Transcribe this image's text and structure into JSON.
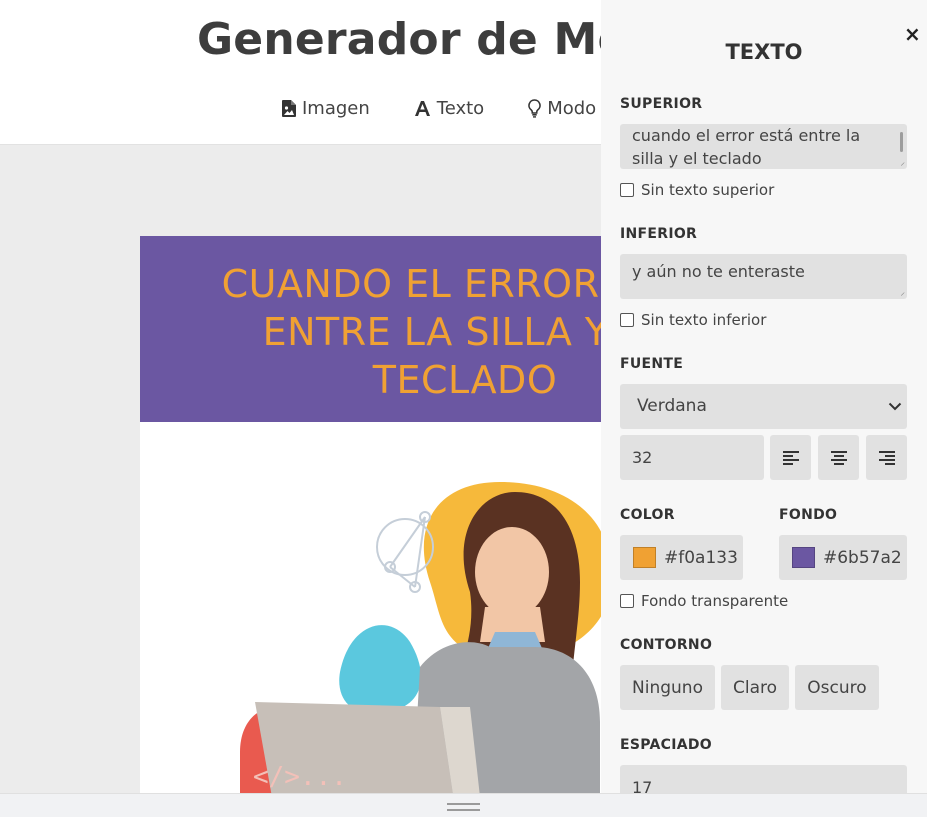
{
  "header": {
    "title": "Generador de Memes",
    "nav": [
      {
        "label": "Imagen",
        "icon": "image-file-icon"
      },
      {
        "label": "Texto",
        "icon": "font-icon"
      },
      {
        "label": "Modo oscuro",
        "icon": "lightbulb-icon"
      }
    ]
  },
  "meme": {
    "top_text": "cuando el error está entre la silla y el teclado",
    "image_caption": "</>..."
  },
  "panel": {
    "title": "TEXTO",
    "close_icon": "close-icon",
    "superior": {
      "label": "SUPERIOR",
      "value": "cuando el error está entre la silla y el teclado",
      "checkbox_label": "Sin texto superior",
      "checked": false
    },
    "inferior": {
      "label": "INFERIOR",
      "value": "y aún no te enteraste",
      "checkbox_label": "Sin texto inferior",
      "checked": false
    },
    "fuente": {
      "label": "FUENTE",
      "selected": "Verdana",
      "size": "32",
      "align_icons": [
        "align-left-icon",
        "align-center-icon",
        "align-right-icon"
      ]
    },
    "color": {
      "label": "COLOR",
      "value": "#f0a133",
      "swatch": "#f0a133"
    },
    "fondo": {
      "label": "FONDO",
      "value": "#6b57a2",
      "swatch": "#6b57a2",
      "transparent_label": "Fondo transparente",
      "transparent_checked": false
    },
    "contorno": {
      "label": "CONTORNO",
      "options": [
        "Ninguno",
        "Claro",
        "Oscuro"
      ]
    },
    "espaciado": {
      "label": "ESPACIADO",
      "value": "17"
    }
  },
  "colors": {
    "meme_bg": "#6b57a2",
    "meme_text": "#f0a133",
    "panel_bg": "#f7f7f7",
    "input_bg": "#e1e1e1"
  }
}
